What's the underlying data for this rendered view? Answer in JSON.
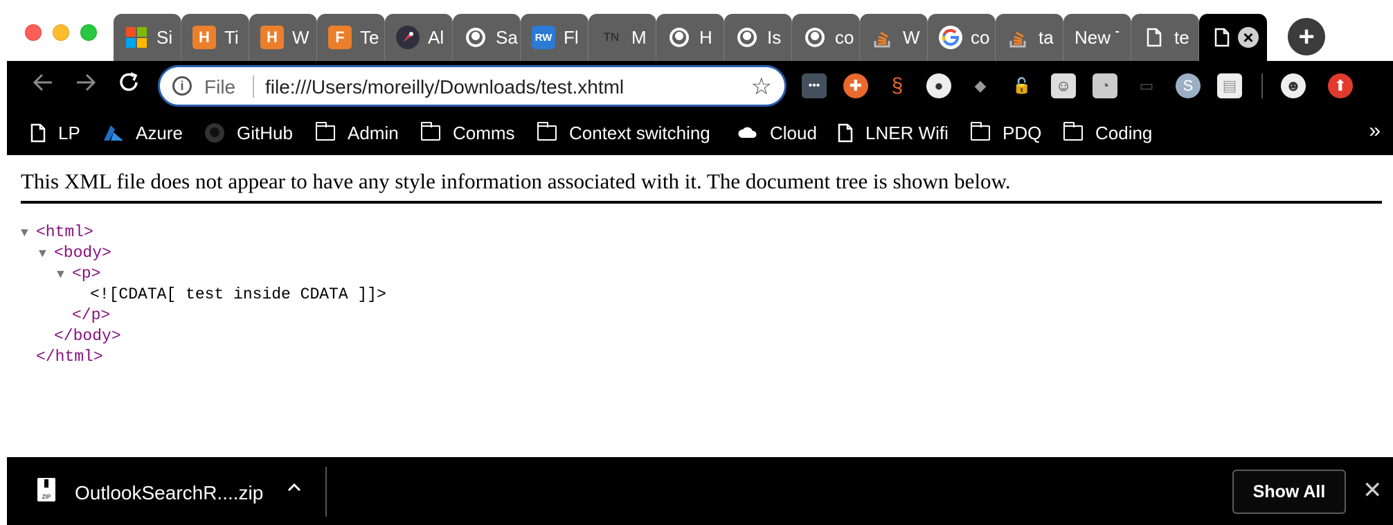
{
  "tabs": [
    {
      "label": "Si",
      "icon": "microsoft-icon",
      "color": "#f25022"
    },
    {
      "label": "Ti",
      "icon": "h-icon",
      "color": "#ec7f2c",
      "glyph": "H"
    },
    {
      "label": "W",
      "icon": "h-icon",
      "color": "#ec7f2c",
      "glyph": "H"
    },
    {
      "label": "Te",
      "icon": "f-icon",
      "color": "#ec7f2c",
      "glyph": "F"
    },
    {
      "label": "Al",
      "icon": "app-icon",
      "color": "#2f2f3f"
    },
    {
      "label": "Sa",
      "icon": "github-icon",
      "color": "#2b2b2b"
    },
    {
      "label": "Fl",
      "icon": "rw-icon",
      "color": "#2a7ad6",
      "glyph": "RW"
    },
    {
      "label": "M",
      "icon": "tn-icon",
      "color": "#5f5f5f",
      "glyph": "TN"
    },
    {
      "label": "H",
      "icon": "github-icon",
      "color": "#2b2b2b"
    },
    {
      "label": "Is",
      "icon": "github-icon",
      "color": "#2b2b2b"
    },
    {
      "label": "co",
      "icon": "github-icon",
      "color": "#2b2b2b"
    },
    {
      "label": "W",
      "icon": "stackoverflow-icon",
      "color": "#f48024"
    },
    {
      "label": "co",
      "icon": "google-icon",
      "color": "#ffffff"
    },
    {
      "label": "ta",
      "icon": "stackoverflow-icon",
      "color": "#f48024"
    },
    {
      "label": "New T",
      "icon": "none"
    },
    {
      "label": "te",
      "icon": "document-icon"
    },
    {
      "label": "",
      "icon": "document-icon",
      "active": true
    }
  ],
  "address": {
    "scheme": "File",
    "url": "file:///Users/moreilly/Downloads/test.xhtml"
  },
  "bookmarks": [
    {
      "label": "LP",
      "icon": "document-icon"
    },
    {
      "label": "Azure",
      "icon": "azure-icon"
    },
    {
      "label": "GitHub",
      "icon": "github-icon"
    },
    {
      "label": "Admin",
      "icon": "folder-icon"
    },
    {
      "label": "Comms",
      "icon": "folder-icon"
    },
    {
      "label": "Context switching",
      "icon": "folder-icon"
    },
    {
      "label": "Cloud",
      "icon": "cloud-icon"
    },
    {
      "label": "LNER Wifi",
      "icon": "document-icon"
    },
    {
      "label": "PDQ",
      "icon": "folder-icon"
    },
    {
      "label": "Coding",
      "icon": "folder-icon"
    }
  ],
  "bookmarks_more": "»",
  "content": {
    "notice": "This XML file does not appear to have any style information associated with it. The document tree is shown below.",
    "tree": [
      {
        "text": "<html>"
      },
      {
        "text": "<body>"
      },
      {
        "text": "<p>"
      },
      {
        "text": "<![CDATA[ test inside CDATA ]]>"
      },
      {
        "text": "</p>"
      },
      {
        "text": "</body>"
      },
      {
        "text": "</html>"
      }
    ]
  },
  "download": {
    "filename": "OutlookSearchR....zip",
    "show_all": "Show All"
  }
}
